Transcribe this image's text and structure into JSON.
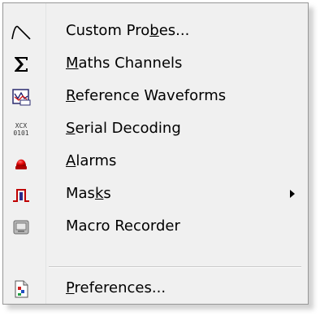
{
  "menu": {
    "items": [
      {
        "pre": "Custom Pro",
        "key": "b",
        "post": "es...",
        "icon": "custom-probe-icon",
        "submenu": false
      },
      {
        "pre": "",
        "key": "M",
        "post": "aths Channels",
        "icon": "sigma-icon",
        "submenu": false
      },
      {
        "pre": "",
        "key": "R",
        "post": "eference Waveforms",
        "icon": "reference-waveform-icon",
        "submenu": false
      },
      {
        "pre": "",
        "key": "S",
        "post": "erial Decoding",
        "icon": "serial-decoding-icon",
        "submenu": false
      },
      {
        "pre": "",
        "key": "A",
        "post": "larms",
        "icon": "alarm-icon",
        "submenu": false
      },
      {
        "pre": "Mas",
        "key": "k",
        "post": "s",
        "icon": "mask-icon",
        "submenu": true
      },
      {
        "pre": "",
        "key": "",
        "post": "Macro Recorder",
        "icon": "macro-recorder-icon",
        "submenu": false
      },
      {
        "pre": "",
        "key": "P",
        "post": "references...",
        "icon": "preferences-icon",
        "submenu": false
      }
    ],
    "serial_icon_text": {
      "top": "XCX",
      "bottom": "0101"
    },
    "colors": {
      "alarm": "#e00000",
      "mask": "#c00000",
      "background": "#f0f0f0"
    }
  }
}
